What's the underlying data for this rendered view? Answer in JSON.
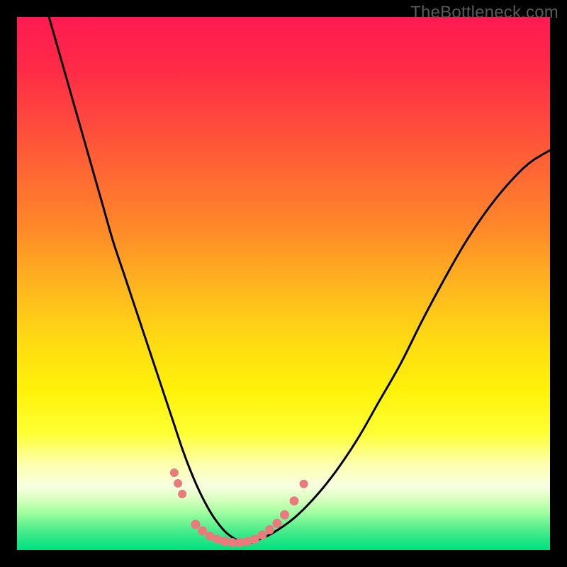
{
  "watermark": "TheBottleneck.com",
  "chart_data": {
    "type": "line",
    "title": "",
    "xlabel": "",
    "ylabel": "",
    "xlim": [
      0,
      100
    ],
    "ylim": [
      0,
      100
    ],
    "background": {
      "type": "vertical-gradient",
      "stops": [
        {
          "offset": 0.0,
          "color": "#ff1a52"
        },
        {
          "offset": 0.1,
          "color": "#ff2b47"
        },
        {
          "offset": 0.2,
          "color": "#ff4a3d"
        },
        {
          "offset": 0.3,
          "color": "#ff6a33"
        },
        {
          "offset": 0.4,
          "color": "#ff8a29"
        },
        {
          "offset": 0.5,
          "color": "#ffb41f"
        },
        {
          "offset": 0.6,
          "color": "#ffd814"
        },
        {
          "offset": 0.7,
          "color": "#fff20a"
        },
        {
          "offset": 0.78,
          "color": "#ffff33"
        },
        {
          "offset": 0.84,
          "color": "#fdffb0"
        },
        {
          "offset": 0.88,
          "color": "#f8ffe0"
        },
        {
          "offset": 0.905,
          "color": "#d8ffc0"
        },
        {
          "offset": 0.93,
          "color": "#a0ffa0"
        },
        {
          "offset": 0.955,
          "color": "#60f090"
        },
        {
          "offset": 0.975,
          "color": "#30e888"
        },
        {
          "offset": 1.0,
          "color": "#00e080"
        }
      ]
    },
    "series": [
      {
        "name": "bottleneck-curve",
        "color": "#000000",
        "x": [
          6,
          8,
          10,
          12,
          14,
          16,
          18,
          20,
          22,
          24,
          26,
          28,
          29.5,
          31,
          32.5,
          34,
          35.5,
          37,
          39,
          41,
          43,
          45,
          48,
          52,
          56,
          60,
          64,
          68,
          72,
          76,
          80,
          84,
          88,
          92,
          96,
          100
        ],
        "y": [
          100,
          93,
          86,
          79,
          72,
          65,
          58,
          52,
          46,
          40,
          34,
          28,
          23.5,
          19,
          15,
          11.5,
          8.5,
          6,
          3.5,
          2,
          1.2,
          1.8,
          3.2,
          6,
          10,
          15,
          21,
          28,
          35,
          43,
          50.5,
          57.5,
          63.5,
          68.5,
          72.5,
          75
        ]
      }
    ],
    "markers": {
      "name": "highlighted-points",
      "color": "#e97b7d",
      "points": [
        {
          "x": 29.5,
          "y": 14.5,
          "r": 6
        },
        {
          "x": 30.2,
          "y": 12.5,
          "r": 6
        },
        {
          "x": 31.0,
          "y": 10.5,
          "r": 6
        },
        {
          "x": 33.5,
          "y": 4.8,
          "r": 6.5
        },
        {
          "x": 34.8,
          "y": 3.6,
          "r": 6.5
        },
        {
          "x": 36.2,
          "y": 2.6,
          "r": 6.5
        },
        {
          "x": 37.6,
          "y": 2.0,
          "r": 6.5
        },
        {
          "x": 39.0,
          "y": 1.6,
          "r": 6.5
        },
        {
          "x": 40.4,
          "y": 1.4,
          "r": 6.5
        },
        {
          "x": 41.8,
          "y": 1.4,
          "r": 6.5
        },
        {
          "x": 43.2,
          "y": 1.6,
          "r": 6.5
        },
        {
          "x": 44.6,
          "y": 2.0,
          "r": 6.5
        },
        {
          "x": 46.0,
          "y": 2.8,
          "r": 6.5
        },
        {
          "x": 47.4,
          "y": 3.8,
          "r": 6.5
        },
        {
          "x": 48.8,
          "y": 5.0,
          "r": 6.5
        },
        {
          "x": 50.2,
          "y": 6.6,
          "r": 6.5
        },
        {
          "x": 52.0,
          "y": 9.2,
          "r": 6.5
        },
        {
          "x": 53.8,
          "y": 12.4,
          "r": 6
        }
      ]
    }
  }
}
